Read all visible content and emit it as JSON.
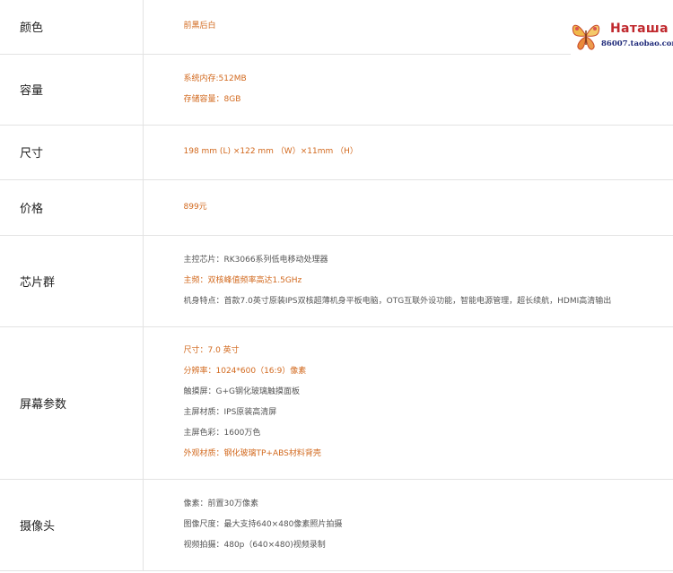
{
  "watermark": {
    "name": "Наташа",
    "url": "86007.taobao.com"
  },
  "rows": [
    {
      "label": "颜色",
      "lines": [
        {
          "text": "前黑后白",
          "color": "orange"
        }
      ]
    },
    {
      "label": "容量",
      "lines": [
        {
          "text": "系统内存:512MB",
          "color": "orange"
        },
        {
          "text": "存储容量：8GB",
          "color": "orange"
        }
      ]
    },
    {
      "label": "尺寸",
      "lines": [
        {
          "text": "198 mm (L) ×122 mm （W）×11mm （H）",
          "color": "orange"
        }
      ]
    },
    {
      "label": "价格",
      "lines": [
        {
          "text": "899元",
          "color": "orange"
        }
      ]
    },
    {
      "label": "芯片群",
      "lines": [
        {
          "text": "主控芯片：RK3066系列低电移动处理器",
          "color": "gray"
        },
        {
          "text": "主频：双核峰值频率高达1.5GHz",
          "color": "orange"
        },
        {
          "text": "机身特点：首款7.0英寸原装IPS双核超薄机身平板电脑，OTG互联外设功能，智能电源管理，超长续航，HDMI高清输出",
          "color": "gray"
        }
      ]
    },
    {
      "label": "屏幕参数",
      "lines": [
        {
          "text": "尺寸：7.0 英寸",
          "color": "orange"
        },
        {
          "text": "分辨率：1024*600（16:9）像素",
          "color": "orange"
        },
        {
          "text": "触摸屏：G+G钢化玻璃触摸面板",
          "color": "gray"
        },
        {
          "text": "主屏材质：IPS原装高清屏",
          "color": "gray"
        },
        {
          "text": "主屏色彩：1600万色",
          "color": "gray"
        },
        {
          "text": "外观材质：钢化玻璃TP+ABS材料背壳",
          "color": "orange"
        }
      ]
    },
    {
      "label": "摄像头",
      "lines": [
        {
          "text": "像素：前置30万像素",
          "color": "gray"
        },
        {
          "text": "图像尺度：最大支持640×480像素照片拍摄",
          "color": "gray"
        },
        {
          "text": "视频拍摄：480p（640×480)视频录制",
          "color": "gray"
        }
      ]
    }
  ]
}
